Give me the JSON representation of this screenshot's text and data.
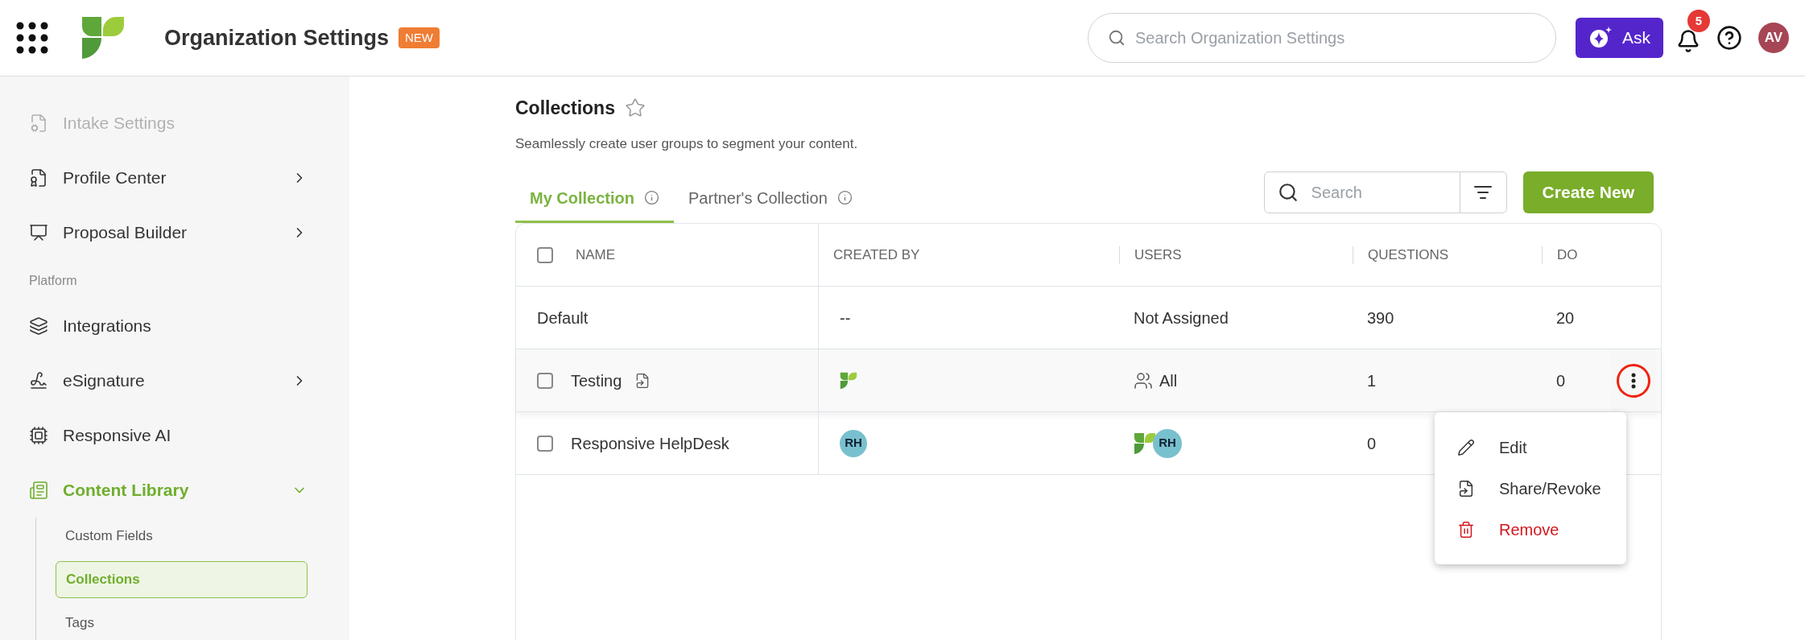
{
  "top_bar": {
    "title": "Organization Settings",
    "badge": "NEW",
    "search": {
      "placeholder": "Search Organization Settings"
    },
    "ask_button": "Ask",
    "notification_count": "5",
    "avatar": "AV"
  },
  "sidebar": {
    "entries": [
      {
        "kind": "item",
        "label": "Intake Settings",
        "disabled": true,
        "selected": false
      },
      {
        "kind": "item",
        "label": "Profile Center",
        "disabled": false,
        "expanded": false,
        "selected": false
      },
      {
        "kind": "item",
        "label": "Proposal Builder",
        "disabled": false,
        "expanded": false,
        "selected": false
      },
      {
        "kind": "section",
        "label": "Platform"
      },
      {
        "kind": "item",
        "label": "Integrations",
        "disabled": false,
        "selected": false
      },
      {
        "kind": "item",
        "label": "eSignature",
        "disabled": false,
        "expanded": false,
        "selected": false
      },
      {
        "kind": "item",
        "label": "Responsive AI",
        "disabled": false,
        "selected": false
      },
      {
        "kind": "item",
        "label": "Content Library",
        "disabled": false,
        "expanded": true,
        "selected": true,
        "children": [
          {
            "label": "Custom Fields",
            "selected": false
          },
          {
            "label": "Collections",
            "selected": true
          },
          {
            "label": "Tags",
            "selected": false
          }
        ]
      }
    ]
  },
  "page": {
    "title": "Collections",
    "subtitle": "Seamlessly create user groups to segment your content.",
    "favorite": false
  },
  "tabs": [
    {
      "label": "My Collection",
      "selected": true
    },
    {
      "label": "Partner's Collection",
      "selected": false
    }
  ],
  "toolbar": {
    "search": {
      "placeholder": "Search"
    },
    "create_button": "Create New"
  },
  "table": {
    "columns": [
      "NAME",
      "CREATED BY",
      "USERS",
      "QUESTIONS",
      "DO"
    ],
    "select_all_checked": false,
    "rows": [
      {
        "kind": "default",
        "name": "Default",
        "shared": false,
        "created_by": {
          "kind": "text",
          "text": "--"
        },
        "users": {
          "kind": "text",
          "text": "Not Assigned"
        },
        "questions": "390",
        "column_5": "20",
        "highlighted": false
      },
      {
        "kind": "collection",
        "checked": false,
        "name": "Testing",
        "shared": true,
        "created_by": {
          "kind": "logo"
        },
        "users": {
          "kind": "group",
          "text": "All"
        },
        "questions": "1",
        "column_5": "0",
        "highlighted": true
      },
      {
        "kind": "collection",
        "checked": false,
        "name": "Responsive HelpDesk",
        "shared": false,
        "created_by": {
          "kind": "avatar",
          "text": "RH"
        },
        "users": {
          "kind": "logo_avatar",
          "text": "RH"
        },
        "questions": "0",
        "column_5": "",
        "highlighted": false
      }
    ]
  },
  "row_menu": {
    "items": [
      {
        "kind": "edit",
        "label": "Edit"
      },
      {
        "kind": "share",
        "label": "Share/Revoke"
      },
      {
        "kind": "danger",
        "label": "Remove"
      }
    ]
  }
}
